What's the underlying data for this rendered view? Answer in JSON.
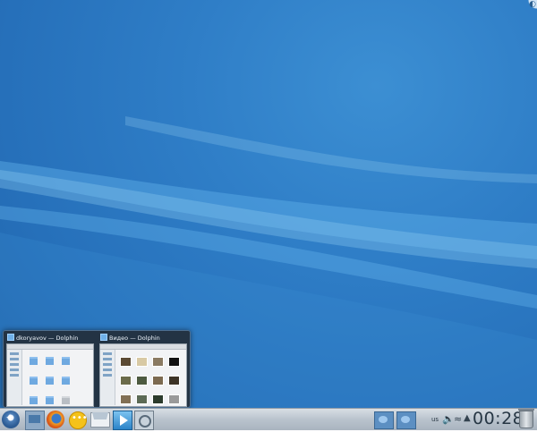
{
  "desktop": {
    "accent_color": "#2f7ec7"
  },
  "task_previews": [
    {
      "title": "dkoryavov — Dolphin",
      "icon": "folder-icon"
    },
    {
      "title": "Видео — Dolphin",
      "icon": "folder-icon"
    }
  ],
  "panel": {
    "launchers": [
      {
        "name": "application-launcher-icon"
      },
      {
        "name": "folder-view-icon"
      },
      {
        "name": "firefox-icon"
      },
      {
        "name": "kopete-chat-icon"
      },
      {
        "name": "kmail-icon"
      },
      {
        "name": "media-player-icon"
      },
      {
        "name": "photo-app-icon"
      }
    ],
    "keyboard_layout": "us",
    "clock": "00:28"
  }
}
